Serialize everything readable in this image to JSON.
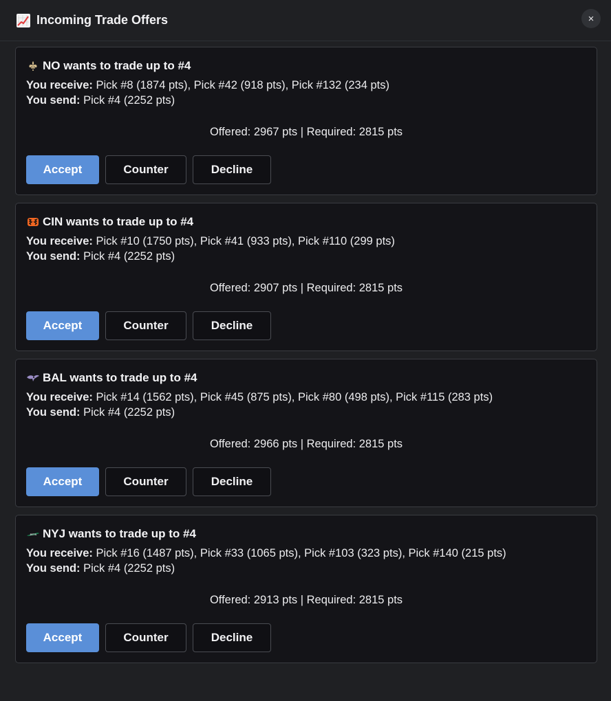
{
  "header": {
    "title": "Incoming Trade Offers",
    "icon": "chart-increasing-icon",
    "close_label": "×"
  },
  "labels": {
    "receive": "You receive:",
    "send": "You send:"
  },
  "offers": [
    {
      "team_logo": "saints-fleur-de-lis-icon",
      "title": "NO wants to trade up to #4",
      "receive": "Pick #8 (1874 pts), Pick #42 (918 pts), Pick #132 (234 pts)",
      "send": "Pick #4 (2252 pts)",
      "summary": "Offered: 2967 pts | Required: 2815 pts",
      "accept": "Accept",
      "counter": "Counter",
      "decline": "Decline"
    },
    {
      "team_logo": "bengals-logo-icon",
      "title": "CIN wants to trade up to #4",
      "receive": "Pick #10 (1750 pts), Pick #41 (933 pts), Pick #110 (299 pts)",
      "send": "Pick #4 (2252 pts)",
      "summary": "Offered: 2907 pts | Required: 2815 pts",
      "accept": "Accept",
      "counter": "Counter",
      "decline": "Decline"
    },
    {
      "team_logo": "ravens-logo-icon",
      "title": "BAL wants to trade up to #4",
      "receive": "Pick #14 (1562 pts), Pick #45 (875 pts), Pick #80 (498 pts), Pick #115 (283 pts)",
      "send": "Pick #4 (2252 pts)",
      "summary": "Offered: 2966 pts | Required: 2815 pts",
      "accept": "Accept",
      "counter": "Counter",
      "decline": "Decline"
    },
    {
      "team_logo": "jets-logo-icon",
      "title": "NYJ wants to trade up to #4",
      "receive": "Pick #16 (1487 pts), Pick #33 (1065 pts), Pick #103 (323 pts), Pick #140 (215 pts)",
      "send": "Pick #4 (2252 pts)",
      "summary": "Offered: 2913 pts | Required: 2815 pts",
      "accept": "Accept",
      "counter": "Counter",
      "decline": "Decline"
    }
  ],
  "colors": {
    "accent": "#5a8fd8",
    "card_bg": "#141418",
    "modal_bg": "#1f2023"
  }
}
